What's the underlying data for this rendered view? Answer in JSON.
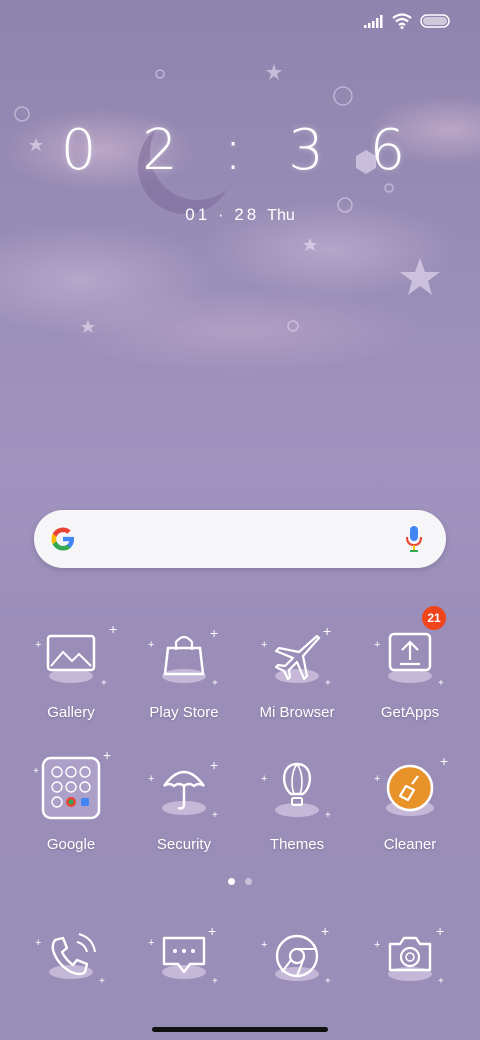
{
  "status_bar": {
    "icons": [
      "signal-icon",
      "wifi-icon",
      "battery-icon"
    ]
  },
  "clock": {
    "time": "0 2 : 3 6"
  },
  "date": {
    "date": "01 · 28",
    "weekday": "Thu"
  },
  "search": {
    "placeholder": ""
  },
  "apps_row1": [
    {
      "label": "Gallery",
      "icon": "gallery-icon"
    },
    {
      "label": "Play Store",
      "icon": "shopping-bag-icon"
    },
    {
      "label": "Mi Browser",
      "icon": "airplane-icon"
    },
    {
      "label": "GetApps",
      "icon": "upload-icon",
      "badge": "21"
    }
  ],
  "apps_row2": [
    {
      "label": "Google",
      "icon": "google-folder-icon"
    },
    {
      "label": "Security",
      "icon": "umbrella-icon"
    },
    {
      "label": "Themes",
      "icon": "hot-air-balloon-icon"
    },
    {
      "label": "Cleaner",
      "icon": "broom-icon"
    }
  ],
  "dock": [
    {
      "icon": "phone-icon"
    },
    {
      "icon": "messages-icon"
    },
    {
      "icon": "chrome-icon"
    },
    {
      "icon": "camera-icon"
    }
  ],
  "page_indicator": {
    "pages": 2,
    "current": 1
  },
  "colors": {
    "background": "#9a8fb8",
    "badge": "#f0441c",
    "cleaner_icon": "#e8922a",
    "searchbar": "#f6f5f8"
  }
}
